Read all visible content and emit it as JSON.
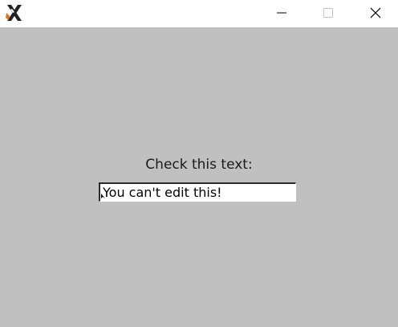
{
  "window": {
    "app_icon": "x-logo-icon",
    "controls": {
      "minimize_icon": "minimize-icon",
      "maximize_icon": "maximize-icon",
      "close_icon": "close-icon"
    }
  },
  "main": {
    "label": "Check this text:",
    "entry": {
      "value": "You can't edit this!",
      "readonly": true
    }
  },
  "colors": {
    "background": "#c0c0c0",
    "titlebar": "#ffffff",
    "entry_background": "#ffffff"
  }
}
